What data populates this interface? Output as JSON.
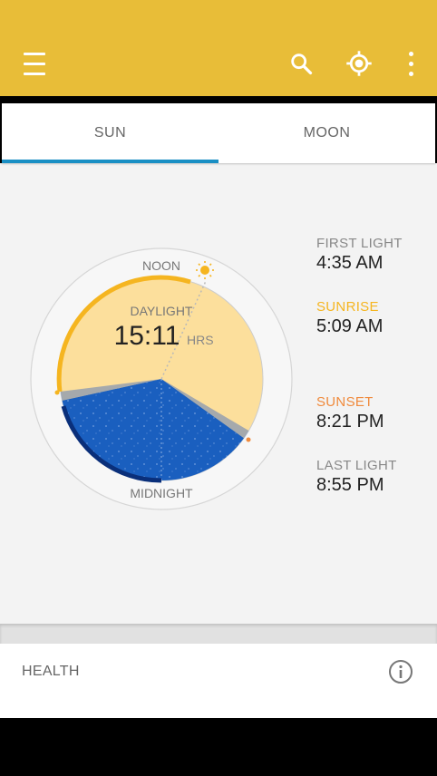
{
  "appbar": {
    "menu_icon": "hamburger-icon",
    "search_icon": "search-icon",
    "location_icon": "my-location-icon",
    "more_icon": "more-vert-icon",
    "color": "#e8bd38"
  },
  "tabs": [
    {
      "label": "SUN",
      "selected": true
    },
    {
      "label": "MOON",
      "selected": false
    }
  ],
  "dial": {
    "noon_label": "NOON",
    "midnight_label": "MIDNIGHT",
    "daylight_label": "DAYLIGHT",
    "daylight_value": "15:11",
    "daylight_unit": "HRS",
    "day_color": "#fcdf9c",
    "night_color": "#1a5fbf"
  },
  "times": {
    "first_light": {
      "label": "FIRST LIGHT",
      "value": "4:35 AM"
    },
    "sunrise": {
      "label": "SUNRISE",
      "value": "5:09 AM",
      "color": "#f5b520"
    },
    "sunset": {
      "label": "SUNSET",
      "value": "8:21 PM",
      "color": "#f08a3c"
    },
    "last_light": {
      "label": "LAST LIGHT",
      "value": "8:55 PM"
    }
  },
  "health": {
    "label": "HEALTH",
    "info_icon": "info-icon"
  }
}
